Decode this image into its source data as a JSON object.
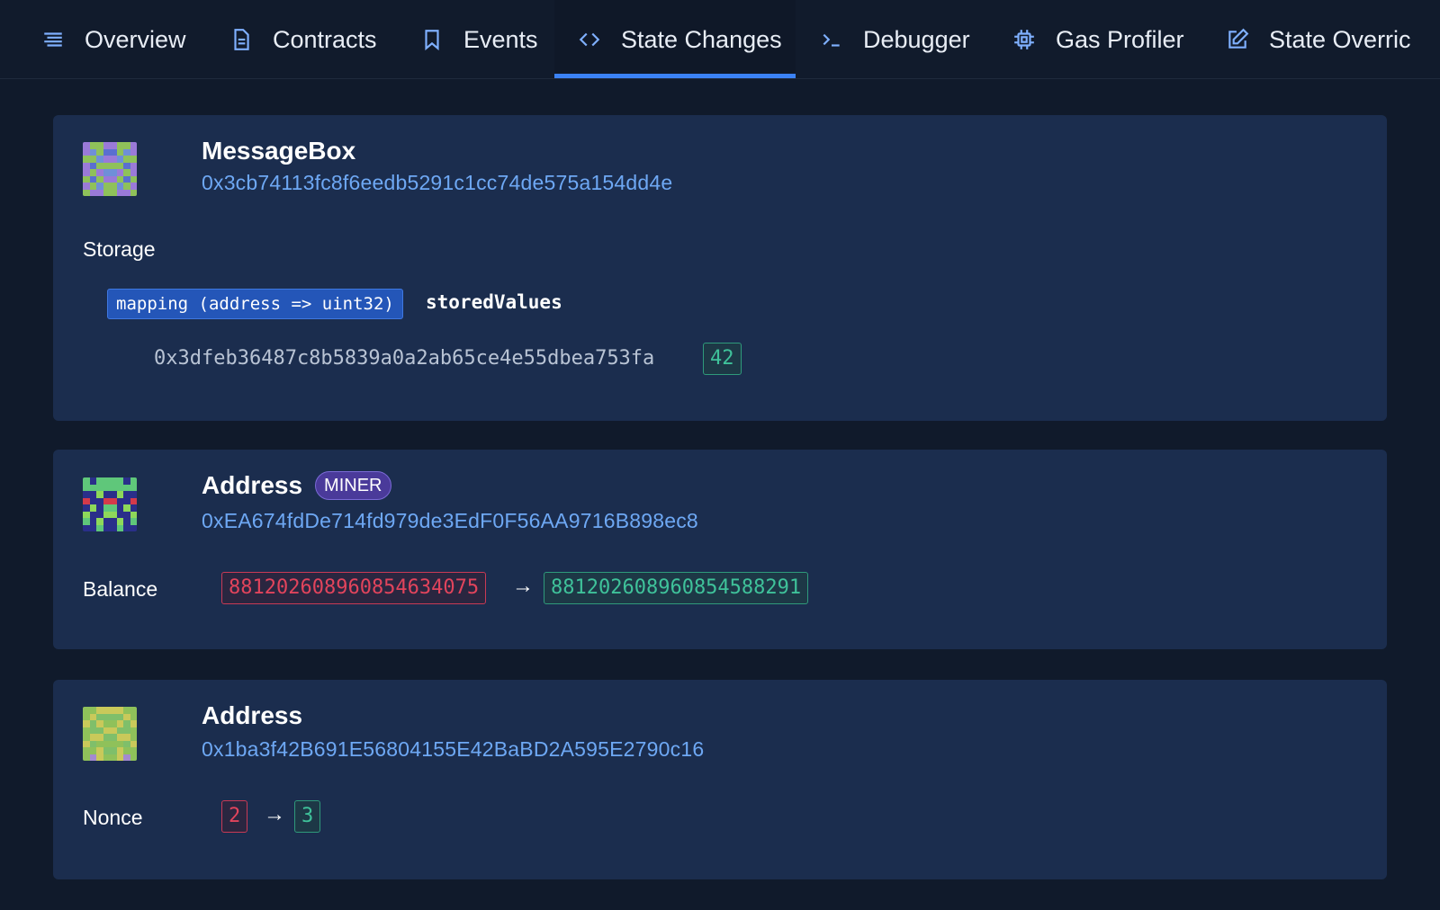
{
  "tabs": [
    {
      "label": "Overview",
      "icon": "list-icon"
    },
    {
      "label": "Contracts",
      "icon": "document-icon"
    },
    {
      "label": "Events",
      "icon": "bookmark-icon"
    },
    {
      "label": "State Changes",
      "icon": "code-icon",
      "active": true
    },
    {
      "label": "Debugger",
      "icon": "terminal-icon"
    },
    {
      "label": "Gas Profiler",
      "icon": "cpu-icon"
    },
    {
      "label": "State Overric",
      "icon": "edit-icon"
    }
  ],
  "cards": [
    {
      "title": "MessageBox",
      "address": "0x3cb74113fc8f6eedb5291c1cc74de575a154dd4e",
      "storage_label": "Storage",
      "type": "mapping (address => uint32)",
      "var_name": "storedValues",
      "key": "0x3dfeb36487c8b5839a0a2ab65ce4e55dbea753fa",
      "value": "42"
    },
    {
      "title": "Address",
      "badge": "MINER",
      "address": "0xEA674fdDe714fd979de3EdF0F56AA9716B898ec8",
      "field_label": "Balance",
      "old_value": "88120260896085463​4075",
      "new_value": "881202608960854588291"
    },
    {
      "title": "Address",
      "address": "0x1ba3f42B691E56804155E42BaBD2A595E2790c16",
      "field_label": "Nonce",
      "old_value": "2",
      "new_value": "3"
    }
  ],
  "arrow": "→",
  "colors": {
    "background": "#101a2b",
    "card": "#1b2d4e",
    "accent": "#3b82f6",
    "address": "#6ea8f4",
    "old_value": "#e2445c",
    "new_value": "#3fc29a",
    "miner_badge": "#4a3a9a"
  }
}
